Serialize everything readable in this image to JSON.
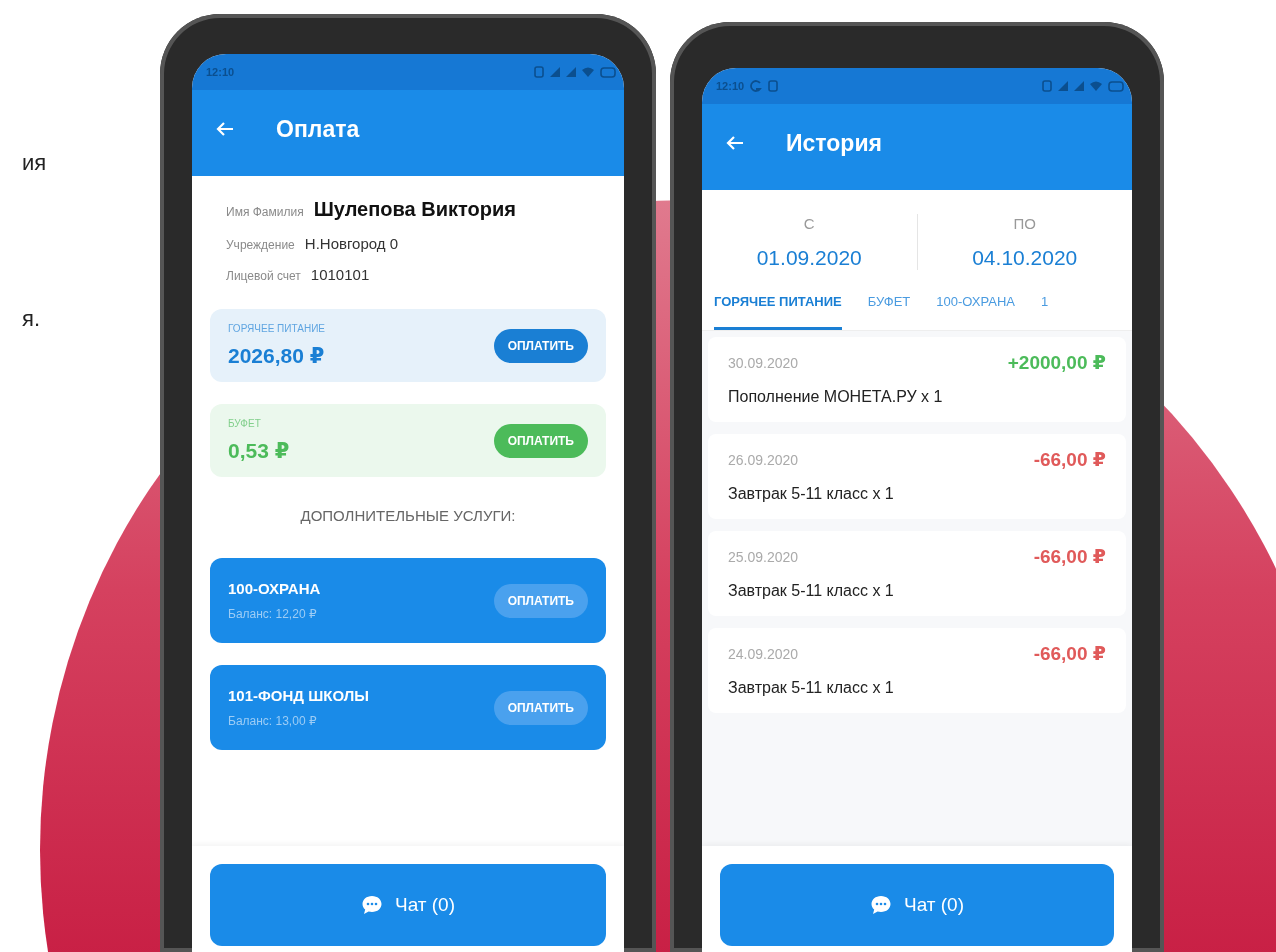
{
  "side_text": [
    "ия",
    "я."
  ],
  "payment_screen": {
    "status_bar": {
      "time": "12:10"
    },
    "app_bar": {
      "title": "Оплата"
    },
    "profile": [
      {
        "kind": "name",
        "label": "Имя Фамилия",
        "value": "Шулепова Виктория"
      },
      {
        "kind": "plain",
        "label": "Учреждение",
        "value": "Н.Новгород  0"
      },
      {
        "kind": "plain",
        "label": "Лицевой счет",
        "value": "1010101"
      }
    ],
    "accounts": [
      {
        "label": "ГОРЯЧЕЕ ПИТАНИЕ",
        "amount": "2026,80 ₽",
        "button": "ОПЛАТИТЬ",
        "color": "#1a7fd4"
      },
      {
        "label": "БУФЕТ",
        "amount": "0,53 ₽",
        "button": "ОПЛАТИТЬ",
        "color": "#4cbb5a"
      }
    ],
    "services_heading": "ДОПОЛНИТЕЛЬНЫЕ УСЛУГИ:",
    "services": [
      {
        "title": "100-ОХРАНА",
        "balance": "Баланс: 12,20 ₽",
        "button": "ОПЛАТИТЬ"
      },
      {
        "title": "101-ФОНД ШКОЛЫ",
        "balance": "Баланс: 13,00 ₽",
        "button": "ОПЛАТИТЬ"
      }
    ],
    "chat_button": "Чат (0)"
  },
  "history_screen": {
    "status_bar": {
      "time": "12:10"
    },
    "app_bar": {
      "title": "История"
    },
    "period": {
      "from_label": "С",
      "from_date": "01.09.2020",
      "to_label": "ПО",
      "to_date": "04.10.2020"
    },
    "tabs": [
      {
        "label": "ГОРЯЧЕЕ ПИТАНИЕ",
        "selected": true
      },
      {
        "label": "БУФЕТ",
        "selected": false
      },
      {
        "label": "100-ОХРАНА",
        "selected": false
      },
      {
        "label": "1",
        "selected": false
      }
    ],
    "transactions": [
      {
        "date": "30.09.2020",
        "amount": "+2000,00 ₽",
        "description": "Пополнение МОНЕТА.РУ x 1",
        "color": "#4cbb5a"
      },
      {
        "date": "26.09.2020",
        "amount": "-66,00 ₽",
        "description": "Завтрак 5-11 класс x 1",
        "color": "#e05a5a"
      },
      {
        "date": "25.09.2020",
        "amount": "-66,00 ₽",
        "description": "Завтрак 5-11 класс x 1",
        "color": "#e05a5a"
      },
      {
        "date": "24.09.2020",
        "amount": "-66,00 ₽",
        "description": "Завтрак 5-11 класс x 1",
        "color": "#e05a5a"
      }
    ],
    "chat_button": "Чат (0)"
  }
}
